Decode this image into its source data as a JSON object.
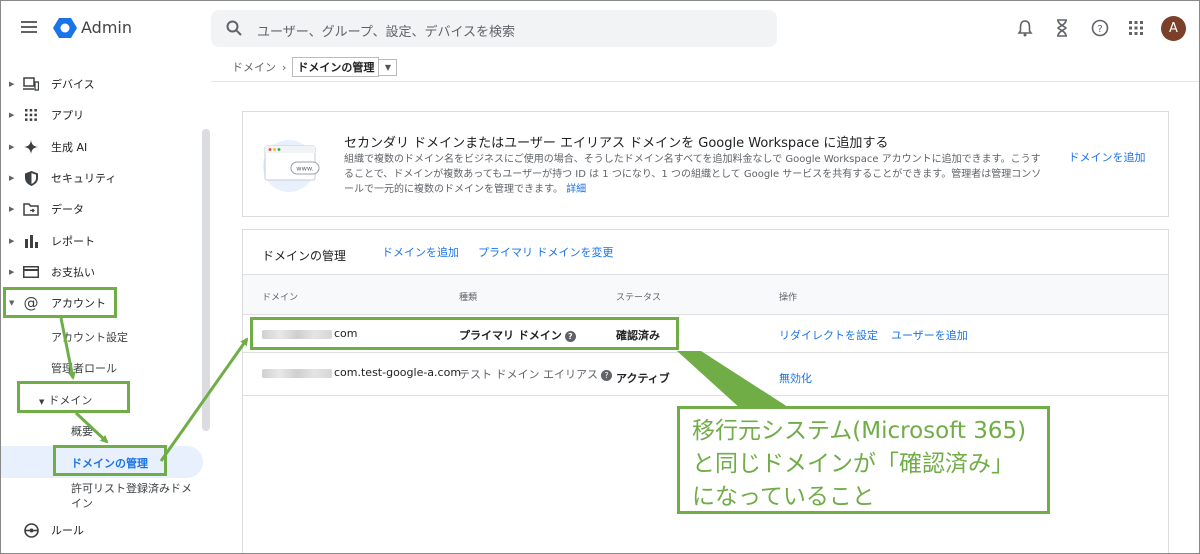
{
  "header": {
    "app_title": "Admin",
    "search_placeholder": "ユーザー、グループ、設定、デバイスを検索",
    "avatar_initial": "A",
    "icons": [
      "bell-icon",
      "hourglass-icon",
      "help-icon",
      "apps-grid-icon"
    ]
  },
  "breadcrumb": {
    "parent": "ドメイン",
    "current": "ドメインの管理"
  },
  "sidebar": {
    "items": [
      {
        "label": "デバイス",
        "icon": "devices-icon"
      },
      {
        "label": "アプリ",
        "icon": "apps-icon"
      },
      {
        "label": "生成 AI",
        "icon": "sparkle-icon"
      },
      {
        "label": "セキュリティ",
        "icon": "shield-icon"
      },
      {
        "label": "データ",
        "icon": "folder-icon"
      },
      {
        "label": "レポート",
        "icon": "bar-chart-icon"
      },
      {
        "label": "お支払い",
        "icon": "credit-card-icon"
      },
      {
        "label": "アカウント",
        "icon": "at-sign-icon"
      }
    ],
    "account_children": {
      "account_settings": "アカウント設定",
      "admin_roles": "管理者ロール",
      "domains": "ドメイン",
      "overview": "概要",
      "manage_domains": "ドメインの管理",
      "allowlist": "許可リスト登録済みドメイン"
    },
    "rules": "ルール"
  },
  "promo": {
    "title": "セカンダリ ドメインまたはユーザー エイリアス ドメインを Google Workspace に追加する",
    "body": "組織で複数のドメイン名をビジネスにご使用の場合、そうしたドメイン名すべてを追加料金なしで Google Workspace アカウントに追加できます。こうすることで、ドメインが複数あってもユーザーが持つ ID は 1 つになり、1 つの組織として Google サービスを共有することができます。管理者は管理コンソールで一元的に複数のドメインを管理できます。",
    "learn_more": "詳細",
    "add_button": "ドメインを追加",
    "illustration_text": "www."
  },
  "domains_card": {
    "title": "ドメインの管理",
    "add_link": "ドメインを追加",
    "change_primary_link": "プライマリ ドメインを変更",
    "columns": [
      "ドメイン",
      "種類",
      "ステータス",
      "操作"
    ],
    "rows": [
      {
        "domain": "com",
        "type": "プライマリ ドメイン",
        "status": "確認済み",
        "actions": [
          "リダイレクトを設定",
          "ユーザーを追加"
        ]
      },
      {
        "domain": "com.test-google-a.com",
        "type": "テスト ドメイン エイリアス",
        "status": "アクティブ",
        "actions": [
          "無効化"
        ]
      }
    ]
  },
  "annotation": {
    "callout_text": "移行元システム(Microsoft 365)と同じドメインが「確認済み」になっていること",
    "color": "#70ad47"
  }
}
